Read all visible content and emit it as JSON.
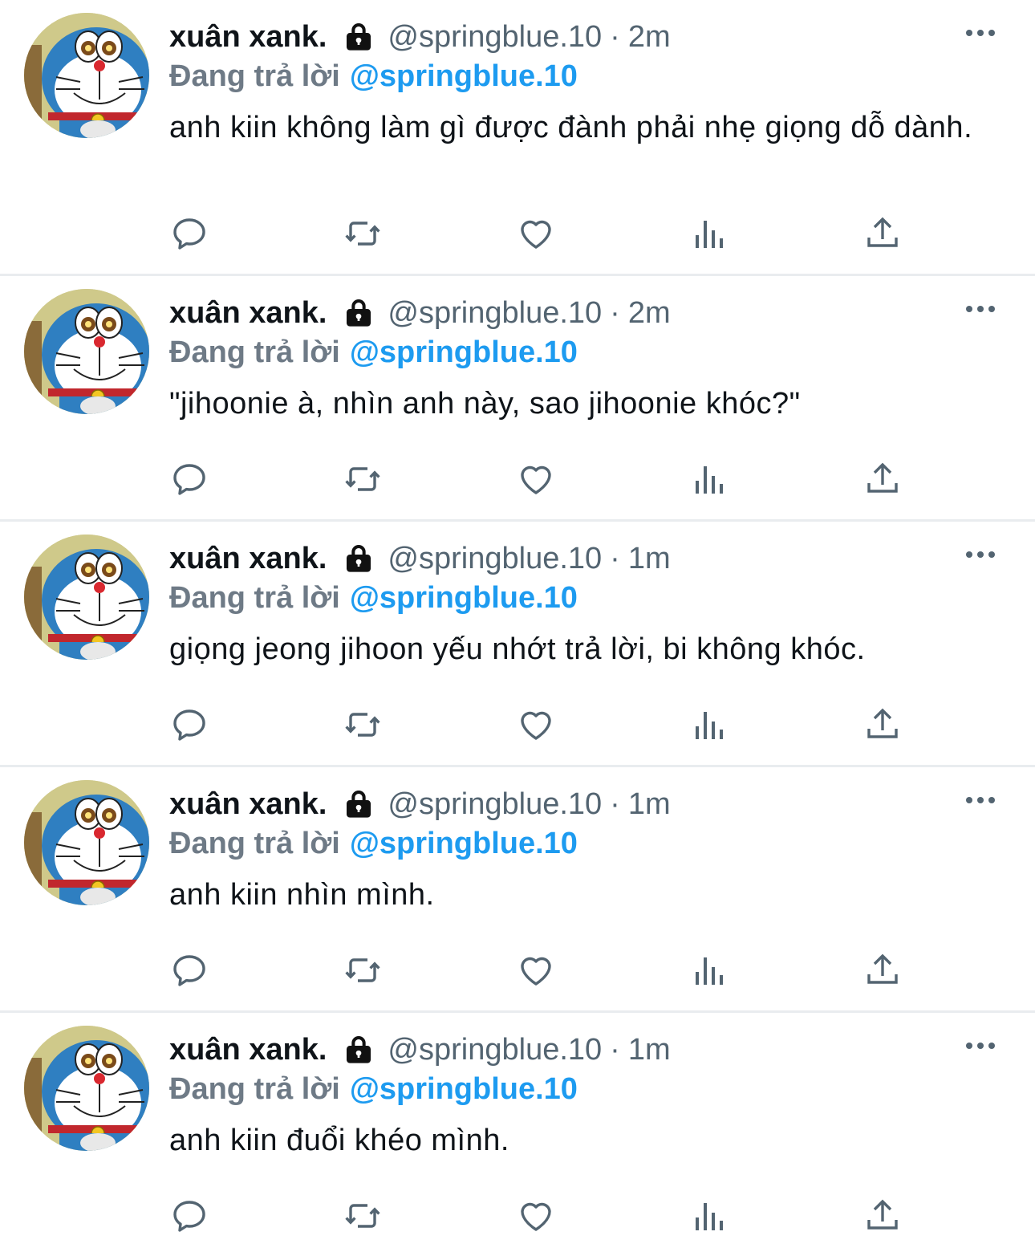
{
  "colors": {
    "text": "#0f1419",
    "secondary": "#536471",
    "reply_prefix": "#6e7a86",
    "link": "#1d9bf0",
    "divider": "#e9ecef",
    "icon": "#536471"
  },
  "icons": {
    "lock": "lock-icon",
    "more": "more-horizontal-icon",
    "reply": "reply-bubble-icon",
    "retweet": "retweet-icon",
    "like": "heart-icon",
    "views": "bar-chart-icon",
    "share": "share-upload-icon"
  },
  "tweets": [
    {
      "display_name": "xuân xank.",
      "handle": "@springblue.10",
      "separator": "·",
      "time": "2m",
      "reply_prefix": "Đang trả lời",
      "reply_to": "@springblue.10",
      "text": "anh kiin không làm gì được đành phải nhẹ giọng dỗ dành."
    },
    {
      "display_name": "xuân xank.",
      "handle": "@springblue.10",
      "separator": "·",
      "time": "2m",
      "reply_prefix": "Đang trả lời",
      "reply_to": "@springblue.10",
      "text": "\"jihoonie à, nhìn anh này, sao jihoonie khóc?\""
    },
    {
      "display_name": "xuân xank.",
      "handle": "@springblue.10",
      "separator": "·",
      "time": "1m",
      "reply_prefix": "Đang trả lời",
      "reply_to": "@springblue.10",
      "text": "giọng jeong jihoon yếu nhớt trả lời, bi không khóc."
    },
    {
      "display_name": "xuân xank.",
      "handle": "@springblue.10",
      "separator": "·",
      "time": "1m",
      "reply_prefix": "Đang trả lời",
      "reply_to": "@springblue.10",
      "text": "anh kiin nhìn mình."
    },
    {
      "display_name": "xuân xank.",
      "handle": "@springblue.10",
      "separator": "·",
      "time": "1m",
      "reply_prefix": "Đang trả lời",
      "reply_to": "@springblue.10",
      "text": "anh kiin đuổi khéo mình."
    }
  ]
}
